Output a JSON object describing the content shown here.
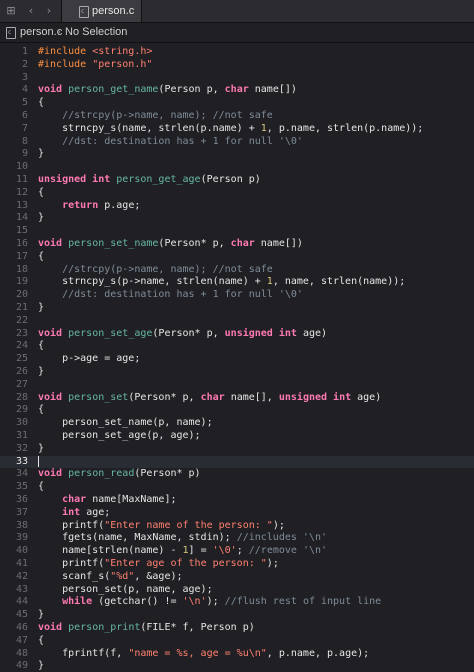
{
  "tabbar": {
    "grid_icon": "⊞",
    "back_icon": "‹",
    "forward_icon": "›",
    "active_tab": "person.c"
  },
  "jumpbar": {
    "file": "person.c",
    "separator": "›",
    "selection": "No Selection"
  },
  "editor": {
    "current_line": 33,
    "lines": [
      {
        "n": "1",
        "tokens": [
          [
            "pp",
            "#include "
          ],
          [
            "str",
            "<string.h>"
          ]
        ]
      },
      {
        "n": "2",
        "tokens": [
          [
            "pp",
            "#include "
          ],
          [
            "str",
            "\"person.h\""
          ]
        ]
      },
      {
        "n": "3",
        "tokens": []
      },
      {
        "n": "4",
        "tokens": [
          [
            "kw",
            "void "
          ],
          [
            "fn",
            "person_get_name"
          ],
          [
            "tx",
            "(Person p, "
          ],
          [
            "kw",
            "char "
          ],
          [
            "tx",
            "name[])"
          ]
        ]
      },
      {
        "n": "5",
        "tokens": [
          [
            "tx",
            "{"
          ]
        ]
      },
      {
        "n": "6",
        "tokens": [
          [
            "cm",
            "    //strcpy(p->name, name); //not safe"
          ]
        ]
      },
      {
        "n": "7",
        "tokens": [
          [
            "tx",
            "    strncpy_s(name, strlen(p.name) + "
          ],
          [
            "num",
            "1"
          ],
          [
            "tx",
            ", p.name, strlen(p.name));"
          ]
        ]
      },
      {
        "n": "8",
        "tokens": [
          [
            "cm",
            "    //dst: destination has + 1 for null '\\0'"
          ]
        ]
      },
      {
        "n": "9",
        "tokens": [
          [
            "tx",
            "}"
          ]
        ]
      },
      {
        "n": "10",
        "tokens": []
      },
      {
        "n": "11",
        "tokens": [
          [
            "kw",
            "unsigned int "
          ],
          [
            "fn",
            "person_get_age"
          ],
          [
            "tx",
            "(Person p)"
          ]
        ]
      },
      {
        "n": "12",
        "tokens": [
          [
            "tx",
            "{"
          ]
        ]
      },
      {
        "n": "13",
        "tokens": [
          [
            "tx",
            "    "
          ],
          [
            "kw",
            "return "
          ],
          [
            "tx",
            "p.age;"
          ]
        ]
      },
      {
        "n": "14",
        "tokens": [
          [
            "tx",
            "}"
          ]
        ]
      },
      {
        "n": "15",
        "tokens": []
      },
      {
        "n": "16",
        "tokens": [
          [
            "kw",
            "void "
          ],
          [
            "fn",
            "person_set_name"
          ],
          [
            "tx",
            "(Person* p, "
          ],
          [
            "kw",
            "char "
          ],
          [
            "tx",
            "name[])"
          ]
        ]
      },
      {
        "n": "17",
        "tokens": [
          [
            "tx",
            "{"
          ]
        ]
      },
      {
        "n": "18",
        "tokens": [
          [
            "cm",
            "    //strcpy(p->name, name); //not safe"
          ]
        ]
      },
      {
        "n": "19",
        "tokens": [
          [
            "tx",
            "    strncpy_s(p->name, strlen(name) + "
          ],
          [
            "num",
            "1"
          ],
          [
            "tx",
            ", name, strlen(name));"
          ]
        ]
      },
      {
        "n": "20",
        "tokens": [
          [
            "cm",
            "    //dst: destination has + 1 for null '\\0'"
          ]
        ]
      },
      {
        "n": "21",
        "tokens": [
          [
            "tx",
            "}"
          ]
        ]
      },
      {
        "n": "22",
        "tokens": []
      },
      {
        "n": "23",
        "tokens": [
          [
            "kw",
            "void "
          ],
          [
            "fn",
            "person_set_age"
          ],
          [
            "tx",
            "(Person* p, "
          ],
          [
            "kw",
            "unsigned int "
          ],
          [
            "tx",
            "age)"
          ]
        ]
      },
      {
        "n": "24",
        "tokens": [
          [
            "tx",
            "{"
          ]
        ]
      },
      {
        "n": "25",
        "tokens": [
          [
            "tx",
            "    p->age = age;"
          ]
        ]
      },
      {
        "n": "26",
        "tokens": [
          [
            "tx",
            "}"
          ]
        ]
      },
      {
        "n": "27",
        "tokens": []
      },
      {
        "n": "28",
        "tokens": [
          [
            "kw",
            "void "
          ],
          [
            "fn",
            "person_set"
          ],
          [
            "tx",
            "(Person* p, "
          ],
          [
            "kw",
            "char "
          ],
          [
            "tx",
            "name[], "
          ],
          [
            "kw",
            "unsigned int "
          ],
          [
            "tx",
            "age)"
          ]
        ]
      },
      {
        "n": "29",
        "tokens": [
          [
            "tx",
            "{"
          ]
        ]
      },
      {
        "n": "30",
        "tokens": [
          [
            "tx",
            "    person_set_name(p, name);"
          ]
        ]
      },
      {
        "n": "31",
        "tokens": [
          [
            "tx",
            "    person_set_age(p, age);"
          ]
        ]
      },
      {
        "n": "32",
        "tokens": [
          [
            "tx",
            "}"
          ]
        ]
      },
      {
        "n": "33",
        "tokens": []
      },
      {
        "n": "34",
        "tokens": [
          [
            "kw",
            "void "
          ],
          [
            "fn",
            "person_read"
          ],
          [
            "tx",
            "(Person* p)"
          ]
        ]
      },
      {
        "n": "35",
        "tokens": [
          [
            "tx",
            "{"
          ]
        ]
      },
      {
        "n": "36",
        "tokens": [
          [
            "tx",
            "    "
          ],
          [
            "kw",
            "char "
          ],
          [
            "tx",
            "name[MaxName];"
          ]
        ]
      },
      {
        "n": "37",
        "tokens": [
          [
            "tx",
            "    "
          ],
          [
            "kw",
            "int "
          ],
          [
            "tx",
            "age;"
          ]
        ]
      },
      {
        "n": "38",
        "tokens": [
          [
            "tx",
            "    printf("
          ],
          [
            "str",
            "\"Enter name of the person: \""
          ],
          [
            "tx",
            ");"
          ]
        ]
      },
      {
        "n": "39",
        "tokens": [
          [
            "tx",
            "    fgets(name, MaxName, stdin); "
          ],
          [
            "cm",
            "//includes '\\n'"
          ]
        ]
      },
      {
        "n": "40",
        "tokens": [
          [
            "tx",
            "    name[strlen(name) - "
          ],
          [
            "num",
            "1"
          ],
          [
            "tx",
            "] = "
          ],
          [
            "str",
            "'\\0'"
          ],
          [
            "tx",
            "; "
          ],
          [
            "cm",
            "//remove '\\n'"
          ]
        ]
      },
      {
        "n": "41",
        "tokens": [
          [
            "tx",
            "    printf("
          ],
          [
            "str",
            "\"Enter age of the person: \""
          ],
          [
            "tx",
            ");"
          ]
        ]
      },
      {
        "n": "42",
        "tokens": [
          [
            "tx",
            "    scanf_s("
          ],
          [
            "str",
            "\"%d\""
          ],
          [
            "tx",
            ", &age);"
          ]
        ]
      },
      {
        "n": "43",
        "tokens": [
          [
            "tx",
            "    person_set(p, name, age);"
          ]
        ]
      },
      {
        "n": "44",
        "tokens": [
          [
            "tx",
            "    "
          ],
          [
            "kw",
            "while "
          ],
          [
            "tx",
            "(getchar() != "
          ],
          [
            "str",
            "'\\n'"
          ],
          [
            "tx",
            "); "
          ],
          [
            "cm",
            "//flush rest of input line"
          ]
        ]
      },
      {
        "n": "45",
        "tokens": [
          [
            "tx",
            "}"
          ]
        ]
      },
      {
        "n": "46",
        "tokens": [
          [
            "kw",
            "void "
          ],
          [
            "fn",
            "person_print"
          ],
          [
            "tx",
            "(FILE* f, Person p)"
          ]
        ]
      },
      {
        "n": "47",
        "tokens": [
          [
            "tx",
            "{"
          ]
        ]
      },
      {
        "n": "48",
        "tokens": [
          [
            "tx",
            "    fprintf(f, "
          ],
          [
            "str",
            "\"name = %s, age = %u\\n\""
          ],
          [
            "tx",
            ", p.name, p.age);"
          ]
        ]
      },
      {
        "n": "49",
        "tokens": [
          [
            "tx",
            "}"
          ]
        ]
      }
    ]
  }
}
